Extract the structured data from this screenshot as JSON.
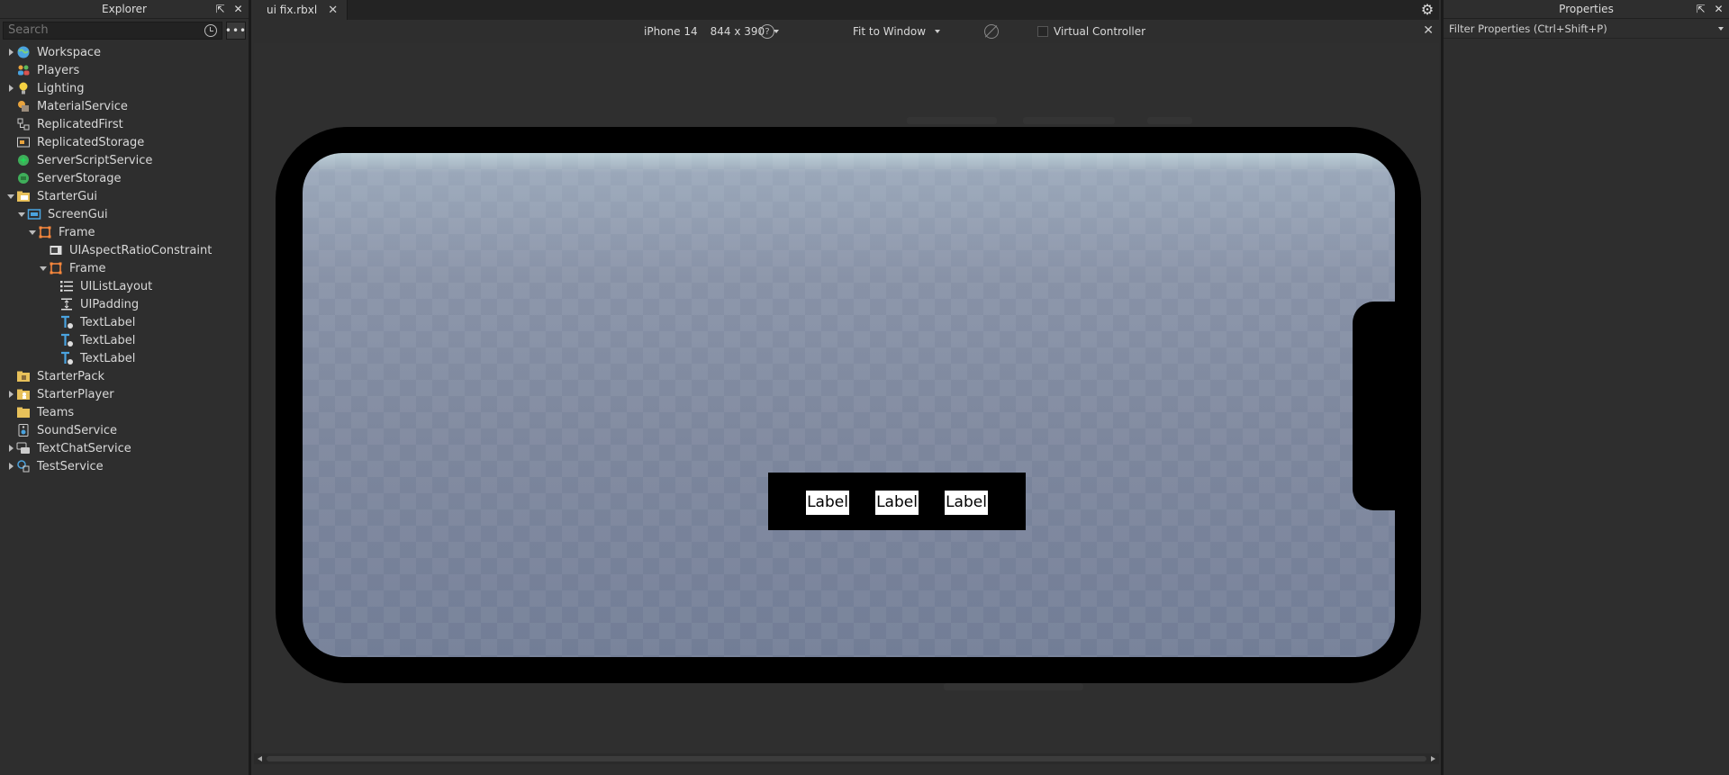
{
  "explorer": {
    "title": "Explorer",
    "search_placeholder": "Search",
    "more_label": "•••",
    "items": [
      {
        "label": "Workspace",
        "caret": "right",
        "icon": "workspace-icon"
      },
      {
        "label": "Players",
        "caret": "none",
        "icon": "players-icon"
      },
      {
        "label": "Lighting",
        "caret": "right",
        "icon": "lighting-icon"
      },
      {
        "label": "MaterialService",
        "caret": "none",
        "icon": "material-service-icon"
      },
      {
        "label": "ReplicatedFirst",
        "caret": "none",
        "icon": "replicated-first-icon"
      },
      {
        "label": "ReplicatedStorage",
        "caret": "none",
        "icon": "replicated-storage-icon"
      },
      {
        "label": "ServerScriptService",
        "caret": "none",
        "icon": "server-script-service-icon"
      },
      {
        "label": "ServerStorage",
        "caret": "none",
        "icon": "server-storage-icon"
      },
      {
        "label": "StarterGui",
        "caret": "down",
        "icon": "starter-gui-icon"
      },
      {
        "label": "ScreenGui",
        "caret": "down",
        "icon": "screen-gui-icon"
      },
      {
        "label": "Frame",
        "caret": "down",
        "icon": "frame-icon"
      },
      {
        "label": "UIAspectRatioConstraint",
        "caret": "none",
        "icon": "aspect-ratio-icon"
      },
      {
        "label": "Frame",
        "caret": "down",
        "icon": "frame-icon"
      },
      {
        "label": "UIListLayout",
        "caret": "none",
        "icon": "list-layout-icon"
      },
      {
        "label": "UIPadding",
        "caret": "none",
        "icon": "padding-icon"
      },
      {
        "label": "TextLabel",
        "caret": "none",
        "icon": "text-label-icon"
      },
      {
        "label": "TextLabel",
        "caret": "none",
        "icon": "text-label-icon"
      },
      {
        "label": "TextLabel",
        "caret": "none",
        "icon": "text-label-icon"
      },
      {
        "label": "StarterPack",
        "caret": "none",
        "icon": "starter-pack-icon"
      },
      {
        "label": "StarterPlayer",
        "caret": "right",
        "icon": "starter-player-icon"
      },
      {
        "label": "Teams",
        "caret": "none",
        "icon": "teams-icon"
      },
      {
        "label": "SoundService",
        "caret": "none",
        "icon": "sound-service-icon"
      },
      {
        "label": "TextChatService",
        "caret": "right",
        "icon": "text-chat-service-icon"
      },
      {
        "label": "TestService",
        "caret": "right",
        "icon": "test-service-icon"
      }
    ]
  },
  "tabs": [
    {
      "label": "ui fix.rbxl"
    }
  ],
  "device_bar": {
    "device": "iPhone 14",
    "resolution": "844 x 390",
    "zoom": "Fit to Window",
    "virtual_controller": "Virtual Controller"
  },
  "game_ui": {
    "labels": [
      "Label",
      "Label",
      "Label"
    ]
  },
  "properties": {
    "title": "Properties",
    "filter_placeholder": "Filter Properties (Ctrl+Shift+P)"
  },
  "colors": {
    "panel_bg": "#2e2e2e",
    "sky": "#b9ccd4",
    "baseplate": "#7d879d",
    "frame_selected": "#ff8a3d"
  }
}
